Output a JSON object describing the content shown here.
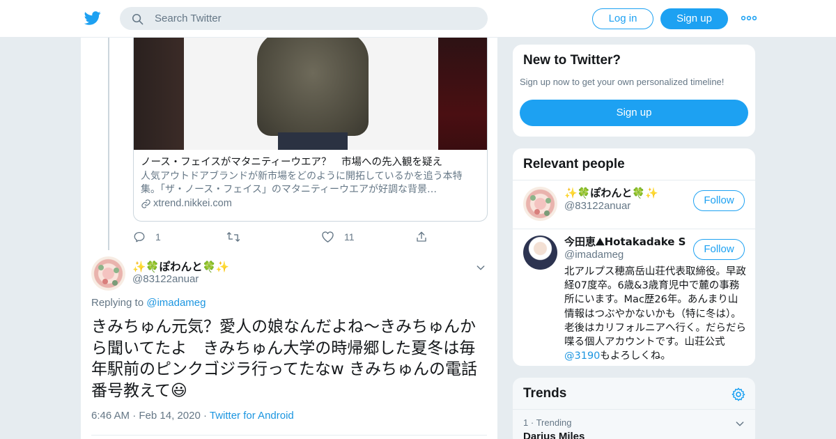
{
  "topbar": {
    "search_placeholder": "Search Twitter",
    "login_label": "Log in",
    "signup_label": "Sign up"
  },
  "card": {
    "title": "ノース・フェイスがマタニティーウエア？　市場への先入観を疑え",
    "description": "人気アウトドアブランドが新市場をどのように開拓しているかを追う本特集。「ザ・ノース・フェイス」のマタニティーウエアが好調な背景…",
    "domain": "xtrend.nikkei.com"
  },
  "parent_actions": {
    "reply_count": "1",
    "retweet_count": "",
    "like_count": "11"
  },
  "reply_tweet": {
    "display_name": "✨🍀ぽわんと🍀✨",
    "handle": "@83122anuar",
    "replying_prefix": "Replying to",
    "replying_to": "@imadameg",
    "text": "きみちゅん元気？愛人の娘なんだよね～きみちゅんから聞いてたよ　きみちゅん大学の時帰郷した夏冬は毎年駅前のピンクゴジラ行ってたなw きみちゅんの電話番号教えて😃",
    "time": "6:46 AM",
    "date": "Feb 14, 2020",
    "source": "Twitter for Android",
    "separator": "·"
  },
  "new_to_twitter": {
    "title": "New to Twitter?",
    "subtitle": "Sign up now to get your own personalized timeline!",
    "signup_label": "Sign up"
  },
  "relevant_people": {
    "title": "Relevant people",
    "people": [
      {
        "name": "✨🍀ぽわんと🍀✨",
        "handle": "@83122anuar",
        "follow_label": "Follow"
      },
      {
        "name": "今田恵⛰Hotakadake S...",
        "handle": "@imadameg",
        "follow_label": "Follow",
        "bio_text": "北アルプス穂高岳山荘代表取締役。早政経07度卒。6歳&3歳育児中で麓の事務所にいます。Mac歴26年。あんまり山情報はつぶやかないかも（特に冬は）。老後はカリフォルニアへ行く。だらだら喋る個人アカウントです。山荘公式",
        "bio_link": "@3190",
        "bio_suffix": "もよろしくね。"
      }
    ]
  },
  "trends": {
    "title": "Trends",
    "items": [
      {
        "rank": "1",
        "separator": "·",
        "meta": "Trending",
        "name": "Darius Miles"
      }
    ]
  },
  "colors": {
    "brand": "#1da1f2",
    "link": "#1b95e0",
    "muted": "#657786",
    "background": "#e6ecf0"
  }
}
